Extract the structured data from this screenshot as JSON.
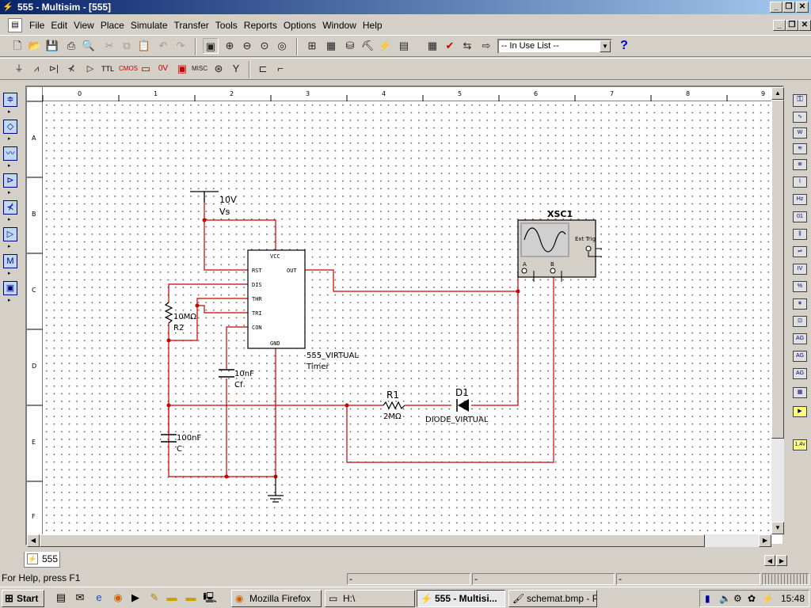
{
  "window": {
    "title": "555 - Multisim - [555]"
  },
  "menu": [
    "File",
    "Edit",
    "View",
    "Place",
    "Simulate",
    "Transfer",
    "Tools",
    "Reports",
    "Options",
    "Window",
    "Help"
  ],
  "toolbar": {
    "in_use_list": "-- In Use List --"
  },
  "ruler": {
    "columns": [
      "0",
      "1",
      "2",
      "3",
      "4",
      "5",
      "6",
      "7",
      "8",
      "9"
    ],
    "rows": [
      "A",
      "B",
      "C",
      "D",
      "E",
      "F"
    ]
  },
  "schematic": {
    "supply_value": "10V",
    "supply_name": "Vs",
    "timer_pins": [
      "VCC",
      "RST",
      "OUT",
      "DIS",
      "THR",
      "TRI",
      "CON",
      "GND"
    ],
    "timer_name": "555_VIRTUAL",
    "timer_label": "Timer",
    "r2_value": "10MΩ",
    "r2_name": "R2",
    "cf_value": "10nF",
    "cf_name": "Cf",
    "c_value": "100nF",
    "c_name": "C",
    "r1_name": "R1",
    "r1_value": "2MΩ",
    "d1_name": "D1",
    "d1_value": "DIODE_VIRTUAL",
    "scope_name": "XSC1",
    "scope_ext": "Ext Trig",
    "scope_a": "A",
    "scope_b": "B",
    "wire_color": "#cc0000"
  },
  "sheet_tab": "555",
  "status": {
    "help": "For Help, press F1",
    "cells": [
      "-",
      "-",
      "-"
    ]
  },
  "taskbar": {
    "start": "Start",
    "tasks": [
      "Mozilla Firefox",
      "H:\\",
      "555 - Multisi...",
      "schemat.bmp - P..."
    ],
    "clock": "15:48"
  }
}
